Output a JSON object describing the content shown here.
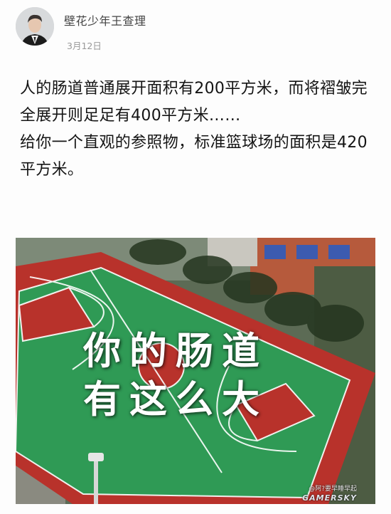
{
  "author": {
    "name": "壁花少年王查理",
    "date": "3月12日",
    "avatar_icon": "profile-photo-avatar"
  },
  "post": {
    "text": "人的肠道普通展开面积有200平方米，而将褶皱完全展开则足足有400平方米……\n给你一个直观的参照物，标准篮球场的面积是420平方米。"
  },
  "image": {
    "overlay_line1": "你的肠道",
    "overlay_line2": "有这么大",
    "watermark_small": "@阿?要早睡早起",
    "watermark_brand": "GAMERSKY",
    "colors": {
      "court_green": "#2f9a55",
      "court_red": "#b8322b",
      "line_white": "#ffffff"
    }
  }
}
